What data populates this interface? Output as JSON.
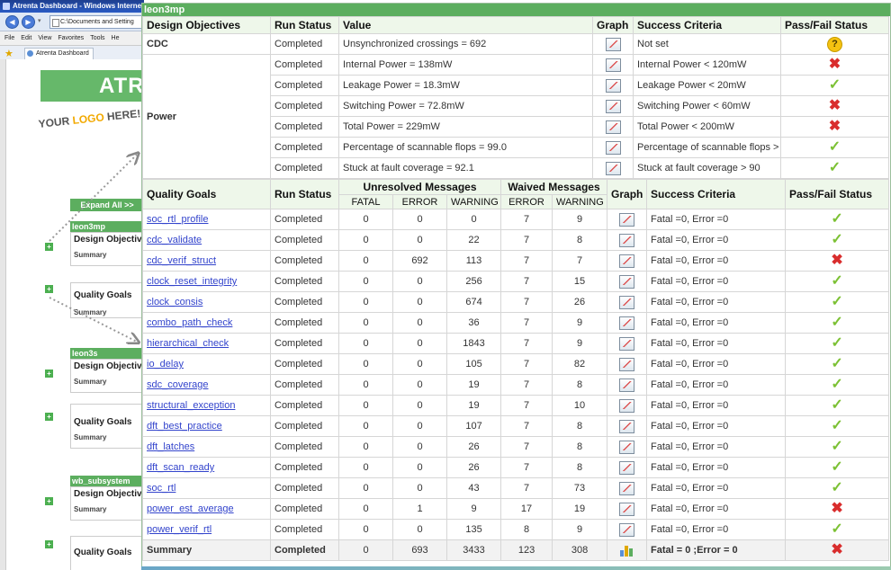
{
  "browser": {
    "title": "Atrenta Dashboard - Windows Interne",
    "address": "C:\\Documents and Setting",
    "menu": [
      "File",
      "Edit",
      "View",
      "Favorites",
      "Tools",
      "He"
    ],
    "tab_label": "Atrenta Dashboard"
  },
  "site": {
    "banner_text": "ATR",
    "logo_your": "YOUR ",
    "logo_logo": "LOGO",
    "logo_here": " HERE!",
    "expand_all": "Expand All >>",
    "projects": [
      {
        "name": "leon3mp",
        "sections": [
          "Design Objectiv",
          "Quality Goals"
        ],
        "summary": "Summary"
      },
      {
        "name": "leon3s",
        "sections": [
          "Design Objectiv",
          "Quality Goals"
        ],
        "summary": "Summary"
      },
      {
        "name": "wb_subsystem",
        "sections": [
          "Design Objectiv",
          "Quality Goals"
        ],
        "summary": "Summary"
      }
    ]
  },
  "popup": {
    "title": "leon3mp",
    "design_headers": {
      "objectives": "Design Objectives",
      "run_status": "Run Status",
      "value": "Value",
      "graph": "Graph",
      "criteria": "Success Criteria",
      "passfail": "Pass/Fail Status"
    },
    "design_groups": [
      "CDC",
      "Power"
    ],
    "design_rows": [
      {
        "status": "Completed",
        "value": "Unsynchronized crossings = 692",
        "criteria": "Not set",
        "result": "unknown"
      },
      {
        "status": "Completed",
        "value": "Internal Power = 138mW",
        "criteria": "Internal Power < 120mW",
        "result": "fail"
      },
      {
        "status": "Completed",
        "value": "Leakage Power = 18.3mW",
        "criteria": "Leakage Power < 20mW",
        "result": "pass"
      },
      {
        "status": "Completed",
        "value": "Switching Power = 72.8mW",
        "criteria": "Switching Power < 60mW",
        "result": "fail"
      },
      {
        "status": "Completed",
        "value": "Total Power = 229mW",
        "criteria": "Total Power < 200mW",
        "result": "fail"
      },
      {
        "status": "Completed",
        "value": "Percentage of scannable flops = 99.0",
        "criteria": "Percentage of scannable flops > 90",
        "result": "pass"
      },
      {
        "status": "Completed",
        "value": "Stuck at fault coverage = 92.1",
        "criteria": "Stuck at fault coverage > 90",
        "result": "pass"
      }
    ],
    "quality_headers": {
      "goals": "Quality Goals",
      "run_status": "Run Status",
      "unresolved": "Unresolved Messages",
      "waived": "Waived Messages",
      "fatal": "FATAL",
      "error": "ERROR",
      "warning": "WARNING",
      "graph": "Graph",
      "criteria": "Success Criteria",
      "passfail": "Pass/Fail Status"
    },
    "quality_rows": [
      {
        "goal": "soc_rtl_profile",
        "status": "Completed",
        "fatal": "0",
        "error": "0",
        "warning": "0",
        "w_error": "7",
        "w_warning": "9",
        "criteria": "Fatal =0, Error =0",
        "result": "pass"
      },
      {
        "goal": "cdc_validate",
        "status": "Completed",
        "fatal": "0",
        "error": "0",
        "warning": "22",
        "w_error": "7",
        "w_warning": "8",
        "criteria": "Fatal =0, Error =0",
        "result": "pass"
      },
      {
        "goal": "cdc_verif_struct",
        "status": "Completed",
        "fatal": "0",
        "error": "692",
        "warning": "113",
        "w_error": "7",
        "w_warning": "7",
        "criteria": "Fatal =0, Error =0",
        "result": "fail"
      },
      {
        "goal": "clock_reset_integrity",
        "status": "Completed",
        "fatal": "0",
        "error": "0",
        "warning": "256",
        "w_error": "7",
        "w_warning": "15",
        "criteria": "Fatal =0, Error =0",
        "result": "pass"
      },
      {
        "goal": "clock_consis",
        "status": "Completed",
        "fatal": "0",
        "error": "0",
        "warning": "674",
        "w_error": "7",
        "w_warning": "26",
        "criteria": "Fatal =0, Error =0",
        "result": "pass"
      },
      {
        "goal": "combo_path_check",
        "status": "Completed",
        "fatal": "0",
        "error": "0",
        "warning": "36",
        "w_error": "7",
        "w_warning": "9",
        "criteria": "Fatal =0, Error =0",
        "result": "pass"
      },
      {
        "goal": "hierarchical_check",
        "status": "Completed",
        "fatal": "0",
        "error": "0",
        "warning": "1843",
        "w_error": "7",
        "w_warning": "9",
        "criteria": "Fatal =0, Error =0",
        "result": "pass"
      },
      {
        "goal": "io_delay",
        "status": "Completed",
        "fatal": "0",
        "error": "0",
        "warning": "105",
        "w_error": "7",
        "w_warning": "82",
        "criteria": "Fatal =0, Error =0",
        "result": "pass"
      },
      {
        "goal": "sdc_coverage",
        "status": "Completed",
        "fatal": "0",
        "error": "0",
        "warning": "19",
        "w_error": "7",
        "w_warning": "8",
        "criteria": "Fatal =0, Error =0",
        "result": "pass"
      },
      {
        "goal": "structural_exception",
        "status": "Completed",
        "fatal": "0",
        "error": "0",
        "warning": "19",
        "w_error": "7",
        "w_warning": "10",
        "criteria": "Fatal =0, Error =0",
        "result": "pass"
      },
      {
        "goal": "dft_best_practice",
        "status": "Completed",
        "fatal": "0",
        "error": "0",
        "warning": "107",
        "w_error": "7",
        "w_warning": "8",
        "criteria": "Fatal =0, Error =0",
        "result": "pass"
      },
      {
        "goal": "dft_latches",
        "status": "Completed",
        "fatal": "0",
        "error": "0",
        "warning": "26",
        "w_error": "7",
        "w_warning": "8",
        "criteria": "Fatal =0, Error =0",
        "result": "pass"
      },
      {
        "goal": "dft_scan_ready",
        "status": "Completed",
        "fatal": "0",
        "error": "0",
        "warning": "26",
        "w_error": "7",
        "w_warning": "8",
        "criteria": "Fatal =0, Error =0",
        "result": "pass"
      },
      {
        "goal": "soc_rtl",
        "status": "Completed",
        "fatal": "0",
        "error": "0",
        "warning": "43",
        "w_error": "7",
        "w_warning": "73",
        "criteria": "Fatal =0, Error =0",
        "result": "pass"
      },
      {
        "goal": "power_est_average",
        "status": "Completed",
        "fatal": "0",
        "error": "1",
        "warning": "9",
        "w_error": "17",
        "w_warning": "19",
        "criteria": "Fatal =0, Error =0",
        "result": "fail"
      },
      {
        "goal": "power_verif_rtl",
        "status": "Completed",
        "fatal": "0",
        "error": "0",
        "warning": "135",
        "w_error": "8",
        "w_warning": "9",
        "criteria": "Fatal =0, Error =0",
        "result": "pass"
      }
    ],
    "summary_row": {
      "goal": "Summary",
      "status": "Completed",
      "fatal": "0",
      "error": "693",
      "warning": "3433",
      "w_error": "123",
      "w_warning": "308",
      "criteria": "Fatal = 0 ;Error = 0",
      "result": "fail"
    },
    "colors": {
      "header_green": "#5cae5f",
      "pass": "#7cc134",
      "fail": "#d92d2d",
      "unknown": "#f5c211"
    },
    "icons": {
      "pass": "✓",
      "fail": "✖",
      "unknown": "?"
    }
  }
}
